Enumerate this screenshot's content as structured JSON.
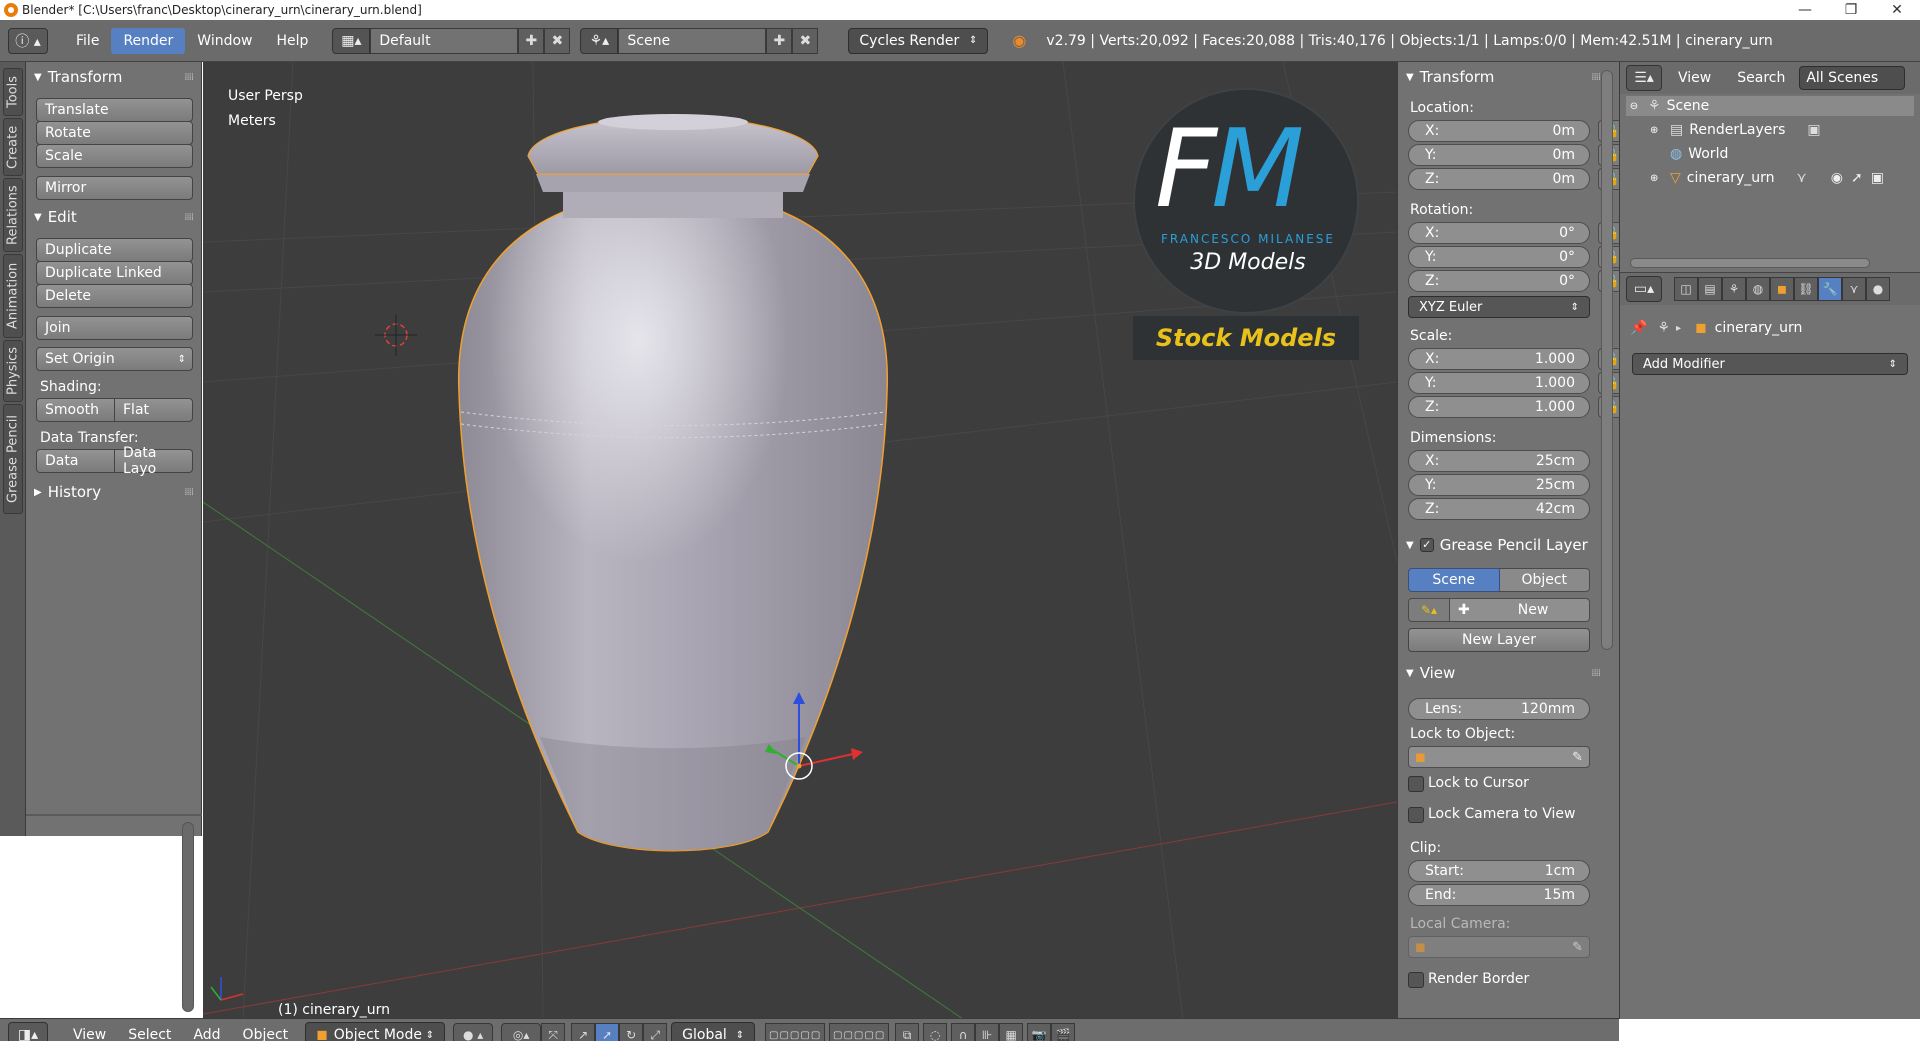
{
  "window": {
    "title": "Blender* [C:\\Users\\franc\\Desktop\\cinerary_urn\\cinerary_urn.blend]",
    "controls": [
      "—",
      "❐",
      "✕"
    ]
  },
  "info_header": {
    "menus": [
      "File",
      "Render",
      "Window",
      "Help"
    ],
    "active_menu": "Render",
    "screen_layout": "Default",
    "scene": "Scene",
    "render_engine": "Cycles Render",
    "stats": "v2.79 | Verts:20,092 | Faces:20,088 | Tris:40,176 | Objects:1/1 | Lamps:0/0 | Mem:42.51M | cinerary_urn"
  },
  "left_tabs": [
    "Tools",
    "Create",
    "Relations",
    "Animation",
    "Physics",
    "Grease Pencil"
  ],
  "tool_shelf": {
    "transform_title": "Transform",
    "translate": "Translate",
    "rotate": "Rotate",
    "scale": "Scale",
    "mirror": "Mirror",
    "edit_title": "Edit",
    "duplicate": "Duplicate",
    "duplicate_linked": "Duplicate Linked",
    "delete": "Delete",
    "join": "Join",
    "set_origin": "Set Origin",
    "shading_label": "Shading:",
    "smooth": "Smooth",
    "flat": "Flat",
    "data_transfer_label": "Data Transfer:",
    "data": "Data",
    "data_layout": "Data Layo",
    "history_title": "History"
  },
  "viewport": {
    "view_name": "User Persp",
    "units": "Meters",
    "object_label": "(1) cinerary_urn",
    "watermark": {
      "monogram_f": "F",
      "monogram_m": "M",
      "author": "FRANCESCO MILANESE",
      "subtitle": "3D Models",
      "banner": "Stock Models"
    }
  },
  "properties_panel": {
    "transform_title": "Transform",
    "location_label": "Location:",
    "location": {
      "x": "0m",
      "y": "0m",
      "z": "0m"
    },
    "rotation_label": "Rotation:",
    "rotation": {
      "x": "0°",
      "y": "0°",
      "z": "0°"
    },
    "rotation_mode": "XYZ Euler",
    "scale_label": "Scale:",
    "scale": {
      "x": "1.000",
      "y": "1.000",
      "z": "1.000"
    },
    "dimensions_label": "Dimensions:",
    "dimensions": {
      "x": "25cm",
      "y": "25cm",
      "z": "42cm"
    },
    "axis_x": "X:",
    "axis_y": "Y:",
    "axis_z": "Z:",
    "gp_title": "Grease Pencil Layer",
    "gp_scene": "Scene",
    "gp_object": "Object",
    "gp_new": "New",
    "gp_new_layer": "New Layer",
    "view_title": "View",
    "lens_label": "Lens:",
    "lens": "120mm",
    "lock_object_label": "Lock to Object:",
    "lock_cursor": "Lock to Cursor",
    "lock_camera": "Lock Camera to View",
    "clip_label": "Clip:",
    "clip_start_label": "Start:",
    "clip_start": "1cm",
    "clip_end_label": "End:",
    "clip_end": "15m",
    "local_camera_label": "Local Camera:",
    "render_border": "Render Border"
  },
  "outliner": {
    "view": "View",
    "search": "Search",
    "filter": "All Scenes",
    "items": [
      "Scene",
      "RenderLayers",
      "World",
      "cinerary_urn"
    ]
  },
  "modifier_props": {
    "object_name": "cinerary_urn",
    "add_modifier": "Add Modifier"
  },
  "bottom_header": {
    "menus": [
      "View",
      "Select",
      "Add",
      "Object"
    ],
    "mode": "Object Mode",
    "orientation": "Global"
  },
  "colors": {
    "accent": "#5680c2",
    "selection_outline": "#f0a030",
    "banner_text": "#e8c21a",
    "logo_blue": "#2a9fd8"
  }
}
